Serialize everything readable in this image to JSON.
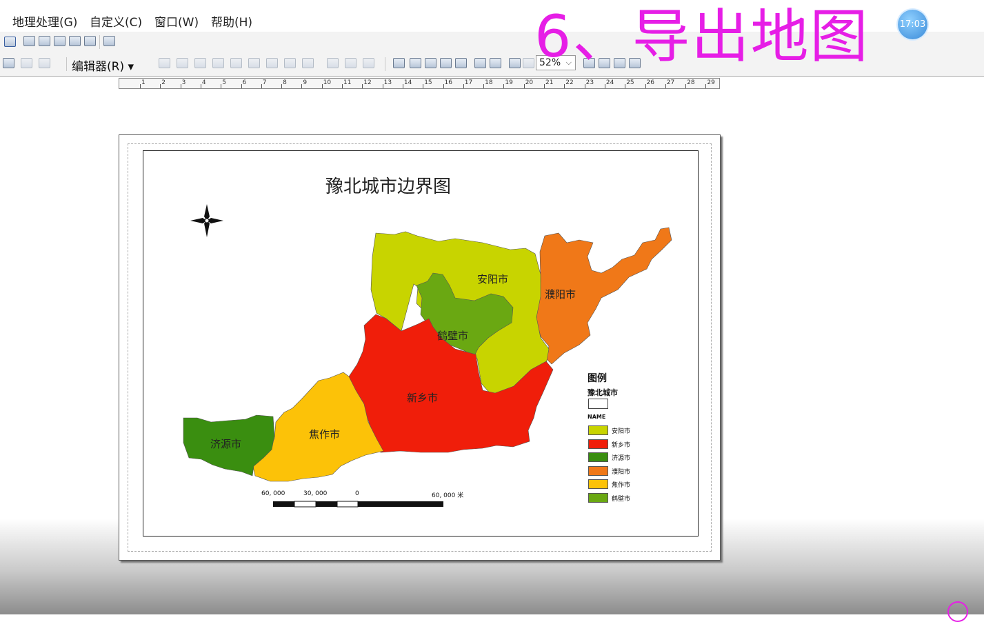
{
  "menu": {
    "geoprocessing": "地理处理(G)",
    "customize": "自定义(C)",
    "windows": "窗口(W)",
    "help": "帮助(H)"
  },
  "toolbar": {
    "editor_label": "编辑器(R)",
    "zoom_value": "52%"
  },
  "ruler": {
    "numbers": [
      "1",
      "2",
      "3",
      "4",
      "5",
      "6",
      "7",
      "8",
      "9",
      "10",
      "11",
      "12",
      "13",
      "14",
      "15",
      "16",
      "17",
      "18",
      "19",
      "20",
      "21",
      "22",
      "23",
      "24",
      "25",
      "26",
      "27",
      "28",
      "29"
    ]
  },
  "overlay": {
    "title": "6、导出地图",
    "clock": "17:03"
  },
  "map": {
    "title": "豫北城市边界图",
    "cities": [
      {
        "name": "安阳市",
        "color": "#c8d400"
      },
      {
        "name": "濮阳市",
        "color": "#f07818"
      },
      {
        "name": "鹤壁市",
        "color": "#6aa812"
      },
      {
        "name": "新乡市",
        "color": "#f01e0a"
      },
      {
        "name": "焦作市",
        "color": "#fcc208"
      },
      {
        "name": "济源市",
        "color": "#3a8e10"
      }
    ],
    "legend": {
      "title": "图例",
      "layer": "豫北城市",
      "field": "NAME",
      "items": [
        {
          "label": "安阳市",
          "color": "#c8d400"
        },
        {
          "label": "新乡市",
          "color": "#f01e0a"
        },
        {
          "label": "济源市",
          "color": "#3a8e10"
        },
        {
          "label": "濮阳市",
          "color": "#f07818"
        },
        {
          "label": "焦作市",
          "color": "#fcc208"
        },
        {
          "label": "鹤壁市",
          "color": "#6aa812"
        }
      ]
    },
    "scale_bar": {
      "left": "60, 000",
      "mid": "30, 000",
      "zero": "0",
      "right": "60, 000 米"
    }
  }
}
